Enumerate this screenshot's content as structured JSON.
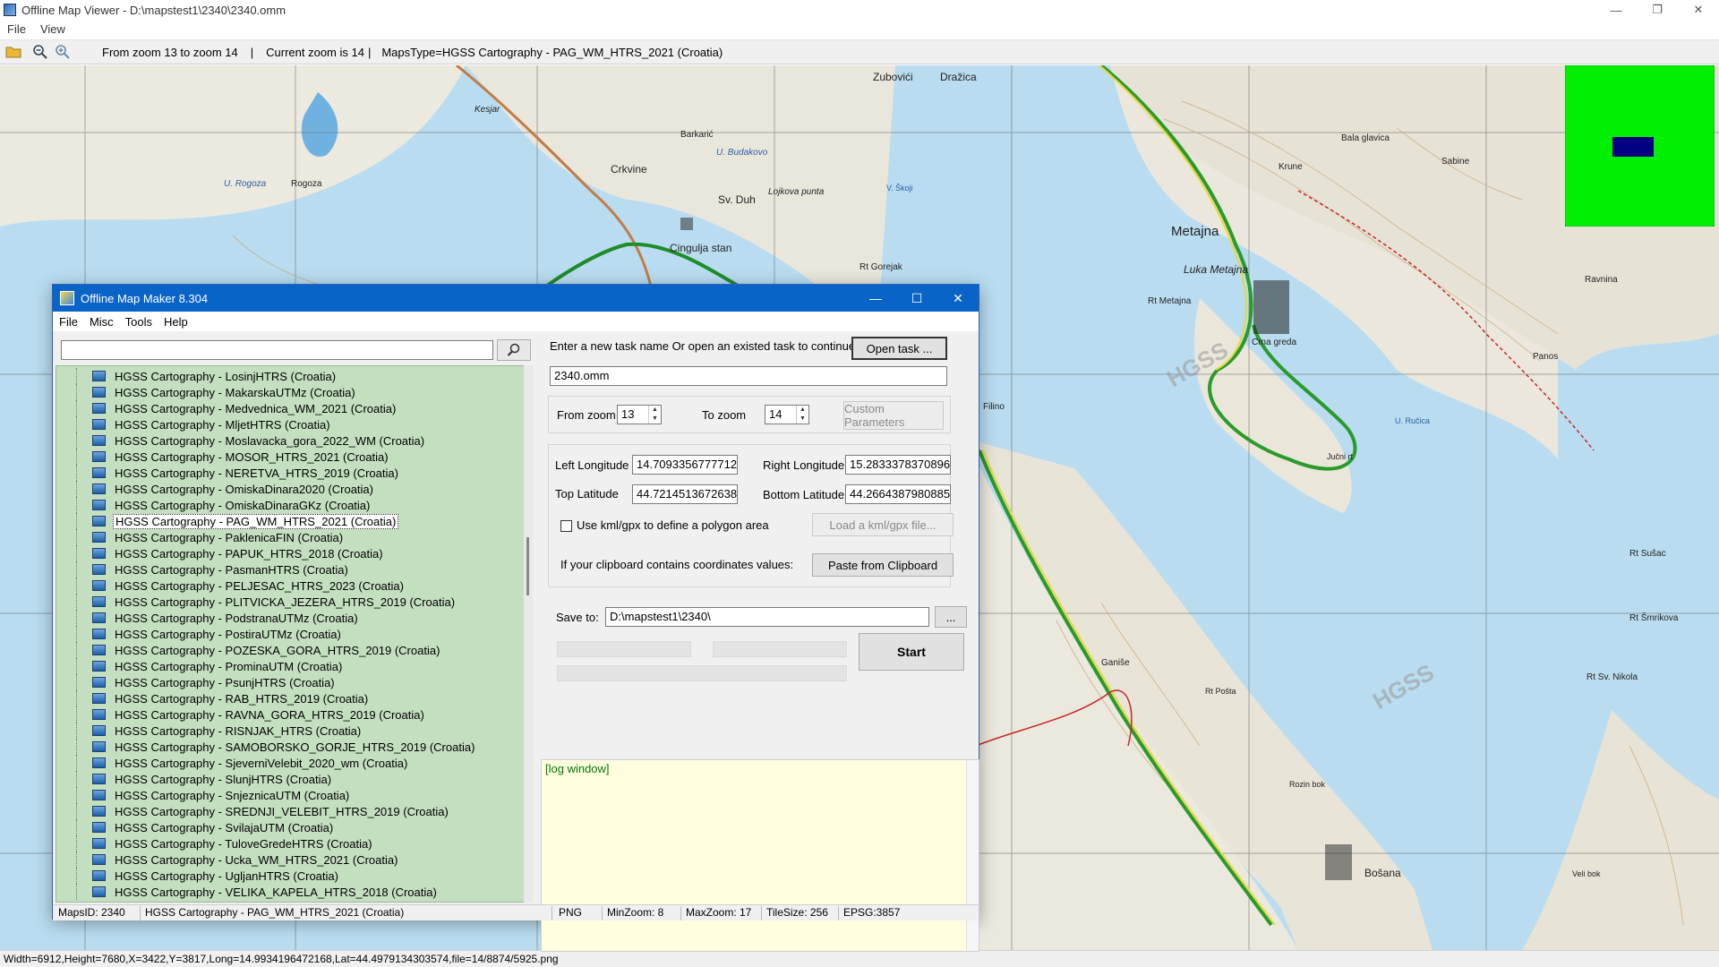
{
  "window": {
    "title": "Offline Map Viewer - D:\\mapstest1\\2340\\2340.omm"
  },
  "menu": [
    "File",
    "View"
  ],
  "toolbar": {
    "zoom_range": "From zoom 13 to zoom 14",
    "current_zoom": "Current zoom is 14",
    "maps_type": "MapsType=HGSS Cartography - PAG_WM_HTRS_2021 (Croatia)",
    "separator": "|"
  },
  "map": {
    "labels": [
      "Zubovići",
      "Dražica",
      "Kesjar",
      "Barkarić",
      "Crkvine",
      "Sv. Duh",
      "Lojkova punta",
      "Cingulja stan",
      "Rogoza",
      "U. Rogoza",
      "U. Budakovo",
      "V. Škoji",
      "Metajna",
      "Luka Metajna",
      "Rt Metajna",
      "Crna greda",
      "Rt Gorejak",
      "Filino",
      "Ravnina",
      "Bala glavica",
      "Krune",
      "Sabine",
      "Panos",
      "Jučni rt",
      "U. Ručica",
      "Rt Sušac",
      "Rt Šmrikova",
      "Rt Sv. Nikola",
      "Ganiše",
      "Rt Pošta",
      "Rozin bok",
      "Bošana",
      "Veli bok",
      "HGSS",
      "Rt Nikola"
    ],
    "overview_color": "#00f000",
    "viewport_color": "#000080"
  },
  "status": "Width=6912,Height=7680,X=3422,Y=3817,Long=14.9934196472168,Lat=44.4979134303574,file=14/8874/5925.png",
  "dialog": {
    "title": "Offline Map Maker 8.304",
    "menu": [
      "File",
      "Misc",
      "Tools",
      "Help"
    ],
    "search_value": "",
    "task_prompt": "Enter a new task name Or open an existed task to continue:",
    "open_task_label": "Open task ...",
    "task_name": "2340.omm",
    "from_zoom_label": "From zoom",
    "from_zoom": "13",
    "to_zoom_label": "To zoom",
    "to_zoom": "14",
    "custom_params_label": "Custom Parameters",
    "left_lon_label": "Left Longitude",
    "left_lon": "14.7093356777712",
    "right_lon_label": "Right Longitude",
    "right_lon": "15.2833378370896",
    "top_lat_label": "Top Latitude",
    "top_lat": "44.7214513672638",
    "bottom_lat_label": "Bottom Latitude",
    "bottom_lat": "44.2664387980885",
    "kml_checkbox_label": "Use kml/gpx to define a polygon area",
    "load_kml_label": "Load a kml/gpx file...",
    "clipboard_prompt": "If your clipboard contains coordinates values:",
    "paste_label": "Paste from Clipboard",
    "save_to_label": "Save to:",
    "save_to": "D:\\mapstest1\\2340\\",
    "browse_label": "...",
    "start_label": "Start",
    "log_text": "[log window]",
    "maps_list": [
      "HGSS Cartography - LosinjHTRS (Croatia)",
      "HGSS Cartography - MakarskaUTMz (Croatia)",
      "HGSS Cartography - Medvednica_WM_2021 (Croatia)",
      "HGSS Cartography - MljetHTRS (Croatia)",
      "HGSS Cartography - Moslavacka_gora_2022_WM (Croatia)",
      "HGSS Cartography - MOSOR_HTRS_2021 (Croatia)",
      "HGSS Cartography - NERETVA_HTRS_2019 (Croatia)",
      "HGSS Cartography - OmiskaDinara2020 (Croatia)",
      "HGSS Cartography - OmiskaDinaraGKz (Croatia)",
      "HGSS Cartography - PAG_WM_HTRS_2021 (Croatia)",
      "HGSS Cartography - PaklenicaFIN (Croatia)",
      "HGSS Cartography - PAPUK_HTRS_2018 (Croatia)",
      "HGSS Cartography - PasmanHTRS (Croatia)",
      "HGSS Cartography - PELJESAC_HTRS_2023 (Croatia)",
      "HGSS Cartography - PLITVICKA_JEZERA_HTRS_2019 (Croatia)",
      "HGSS Cartography - PodstranaUTMz (Croatia)",
      "HGSS Cartography - PostiraUTMz (Croatia)",
      "HGSS Cartography - POZESKA_GORA_HTRS_2019 (Croatia)",
      "HGSS Cartography - ProminaUTM (Croatia)",
      "HGSS Cartography - PsunjHTRS (Croatia)",
      "HGSS Cartography - RAB_HTRS_2019 (Croatia)",
      "HGSS Cartography - RAVNA_GORA_HTRS_2019 (Croatia)",
      "HGSS Cartography - RISNJAK_HTRS (Croatia)",
      "HGSS Cartography - SAMOBORSKO_GORJE_HTRS_2019 (Croatia)",
      "HGSS Cartography - SjeverniVelebit_2020_wm (Croatia)",
      "HGSS Cartography - SlunjHTRS (Croatia)",
      "HGSS Cartography - SnjeznicaUTM (Croatia)",
      "HGSS Cartography - SREDNJI_VELEBIT_HTRS_2019 (Croatia)",
      "HGSS Cartography - SvilajaUTM (Croatia)",
      "HGSS Cartography - TuloveGredeHTRS (Croatia)",
      "HGSS Cartography - Ucka_WM_HTRS_2021 (Croatia)",
      "HGSS Cartography - UgljanHTRS (Croatia)",
      "HGSS Cartography - VELIKA_KAPELA_HTRS_2018 (Croatia)"
    ],
    "selected_map": "HGSS Cartography - PAG_WM_HTRS_2021 (Croatia)",
    "status": {
      "maps_id": "MapsID: 2340",
      "maps_name": "HGSS Cartography - PAG_WM_HTRS_2021 (Croatia)",
      "format": "PNG",
      "min_zoom": "MinZoom: 8",
      "max_zoom": "MaxZoom: 17",
      "tile_size": "TileSize: 256",
      "epsg": "EPSG:3857"
    }
  }
}
